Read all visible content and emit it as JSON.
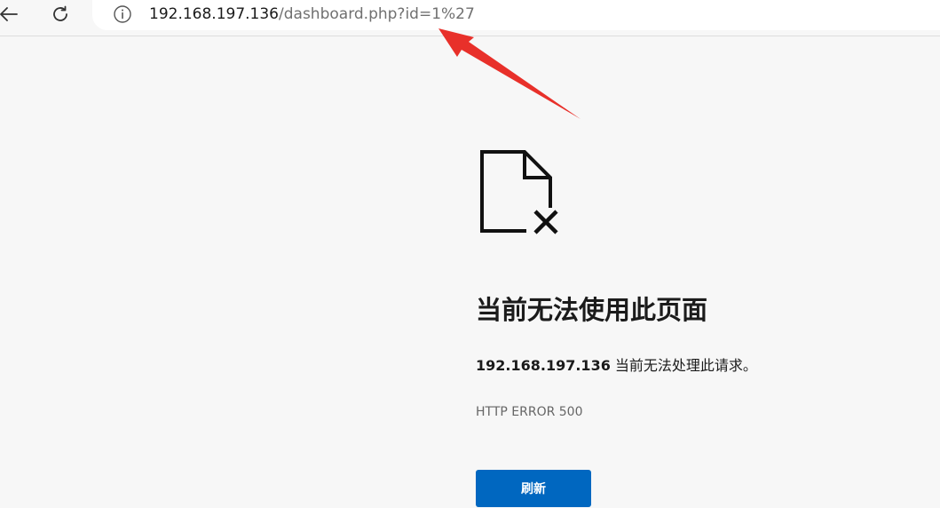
{
  "address_bar": {
    "url_host": "192.168.197.136",
    "url_path": "/dashboard.php?id=1%27"
  },
  "toolbar": {
    "back_icon": "back-arrow-icon",
    "reload_icon": "reload-icon",
    "info_icon": "info-icon"
  },
  "error_page": {
    "icon": "broken-document-icon",
    "title": "当前无法使用此页面",
    "message_host": "192.168.197.136",
    "message_text": " 当前无法处理此请求。",
    "error_code": "HTTP ERROR 500",
    "refresh_label": "刷新"
  },
  "annotation": {
    "arrow_color": "#e8302a"
  },
  "colors": {
    "page_background": "#f7f7f7",
    "button_blue": "#0067c0"
  }
}
